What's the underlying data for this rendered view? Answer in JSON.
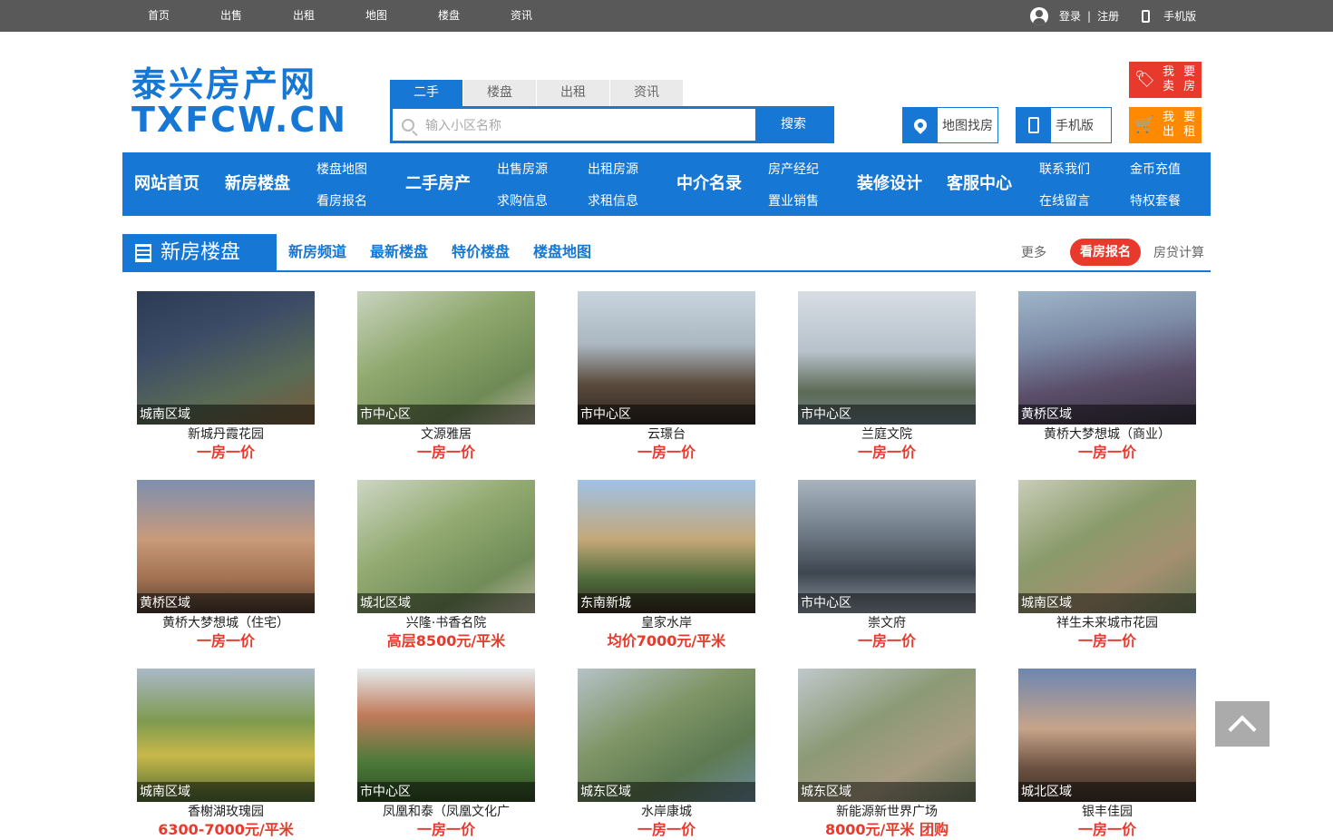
{
  "topnav": [
    "首页",
    "出售",
    "出租",
    "地图",
    "楼盘",
    "资讯"
  ],
  "top_right": {
    "login": "登录",
    "sep": "|",
    "register": "注册",
    "mobile": "手机版"
  },
  "logo": {
    "line1": "泰兴房产网",
    "line2": "TXFCW.CN"
  },
  "search": {
    "tabs": [
      "二手",
      "楼盘",
      "出租",
      "资讯"
    ],
    "placeholder": "输入小区名称",
    "button": "搜索"
  },
  "quick": {
    "map": "地图找房",
    "mobile": "手机版"
  },
  "sell": {
    "sell_line1": "我 要",
    "sell_line2": "卖 房",
    "rent_line1": "我 要",
    "rent_line2": "出 租"
  },
  "mainnav": {
    "home": "网站首页",
    "newhouse": "新房楼盘",
    "lp_map": "楼盘地图",
    "kf_signup": "看房报名",
    "secondhand": "二手房产",
    "sale_src": "出售房源",
    "buy_info": "求购信息",
    "rent_src": "出租房源",
    "rent_info": "求租信息",
    "agents": "中介名录",
    "broker": "房产经纪",
    "sales": "置业销售",
    "decor": "装修设计",
    "service": "客服中心",
    "contact": "联系我们",
    "message": "在线留言",
    "coin": "金币充值",
    "vip": "特权套餐"
  },
  "section": {
    "title": "新房楼盘",
    "links": [
      "新房频道",
      "最新楼盘",
      "特价楼盘",
      "楼盘地图"
    ],
    "more": "更多",
    "signup": "看房报名",
    "loan": "房贷计算"
  },
  "listings": [
    {
      "area": "城南区域",
      "name": "新城丹霞花园",
      "price": "一房一价"
    },
    {
      "area": "市中心区",
      "name": "文源雅居",
      "price": "一房一价"
    },
    {
      "area": "市中心区",
      "name": "云璟台",
      "price": "一房一价"
    },
    {
      "area": "市中心区",
      "name": "兰庭文院",
      "price": "一房一价"
    },
    {
      "area": "黄桥区域",
      "name": "黄桥大梦想城（商业）",
      "price": "一房一价"
    },
    {
      "area": "黄桥区域",
      "name": "黄桥大梦想城（住宅）",
      "price": "一房一价"
    },
    {
      "area": "城北区域",
      "name": "兴隆·书香名院",
      "price": "高层8500元/平米"
    },
    {
      "area": "东南新城",
      "name": "皇家水岸",
      "price": "均价7000元/平米"
    },
    {
      "area": "市中心区",
      "name": "崇文府",
      "price": "一房一价"
    },
    {
      "area": "城南区域",
      "name": "祥生未来城市花园",
      "price": "一房一价"
    },
    {
      "area": "城南区域",
      "name": "香榭湖玫瑰园",
      "price": "6300-7000元/平米"
    },
    {
      "area": "市中心区",
      "name": "凤凰和泰（凤凰文化广",
      "price": "一房一价"
    },
    {
      "area": "城东区域",
      "name": "水岸康城",
      "price": "一房一价"
    },
    {
      "area": "城东区域",
      "name": "新能源新世界广场",
      "price": "8000元/平米 团购"
    },
    {
      "area": "城北区域",
      "name": "银丰佳园",
      "price": "一房一价"
    }
  ],
  "colors": {
    "brand": "#1677d4",
    "topbar": "#595959",
    "price": "#e8392d",
    "sell": "#e8392d",
    "rent": "#ff8a00"
  }
}
